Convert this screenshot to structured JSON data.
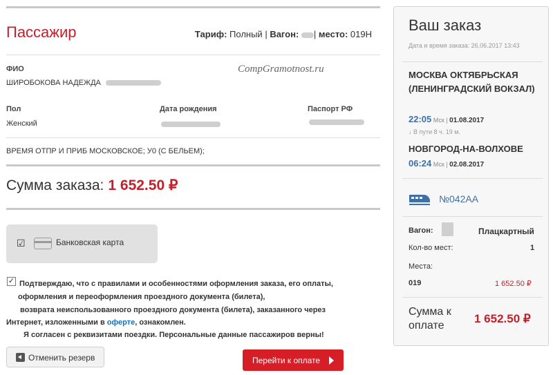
{
  "passenger": {
    "title": "Пассажир",
    "tariff_label": "Тариф:",
    "tariff_value": "Полный",
    "wagon_label": "Вагон:",
    "seat_label": "место:",
    "seat_value": "019Н",
    "fio_label": "ФИО",
    "fio_value": "ШИРОБОКОВА НАДЕЖДА",
    "watermark": "CompGramotnost.ru",
    "sex_label": "Пол",
    "sex_value": "Женский",
    "birth_label": "Дата рождения",
    "passport_label": "Паспорт РФ",
    "note": "ВРЕМЯ ОТПР И ПРИБ МОСКОВСКОЕ; У0 (С БЕЛЬЕМ);"
  },
  "order_sum": {
    "label": "Сумма заказа:",
    "amount": "1 652.50 ₽"
  },
  "payment": {
    "check": "☑",
    "card_label": "Банковская карта"
  },
  "agreement": {
    "check": "✓",
    "line1": "Подтверждаю, что с правилами и особенностями оформления заказа, его оплаты,",
    "line2": "оформления и переоформления   проездного документа (билета),",
    "line3": "возврата неиспользованного проездного документа (билета), заказанного через",
    "line4_before": "Интернет, изложенными в ",
    "line4_link": "оферте",
    "line4_after": ", ознакомлен.",
    "line5": "Я согласен с реквизитами поездки. Персональные данные пассажиров верны!"
  },
  "buttons": {
    "cancel": "Отменить резерв",
    "pay": "Перейти к оплате"
  },
  "summary": {
    "title": "Ваш заказ",
    "date_line": "Дата и время заказа: 26.06.2017 13:43",
    "from_station": "МОСКВА ОКТЯБРЬСКАЯ (ЛЕНИНГРАДСКИЙ ВОКЗАЛ)",
    "dep_time": "22:05",
    "dep_tz": "Мск",
    "dep_date": "01.08.2017",
    "in_way": "↓ В пути 8 ч. 19 м.",
    "to_station": "НОВГОРОД-НА-ВОЛХОВЕ",
    "arr_time": "06:24",
    "arr_tz": "Мск",
    "arr_date": "02.08.2017",
    "train_number": "№042АА",
    "wagon_label": "Вагон:",
    "wagon_type": "Плацкартный",
    "seats_count_label": "Кол-во мест:",
    "seats_count": "1",
    "places_label": "Места:",
    "place": "019",
    "place_price": "1 652.50 ₽",
    "pay_sum_label": "Сумма к оплате",
    "pay_sum": "1 652.50 ₽"
  },
  "colors": {
    "accent_red": "#c4202a",
    "button_red": "#d51e26",
    "link_blue": "#1b6fb3",
    "time_blue": "#3f6fa8"
  }
}
